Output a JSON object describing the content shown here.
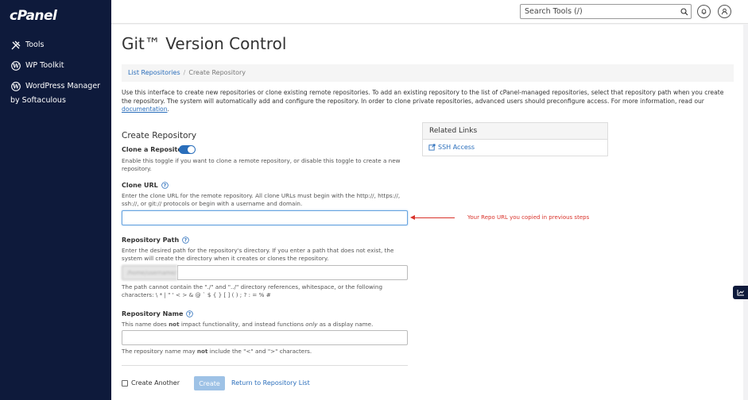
{
  "sidebar": {
    "logo": "cPanel",
    "items": [
      {
        "label": "Tools",
        "icon": "tools-icon"
      },
      {
        "label": "WP Toolkit",
        "icon": "wordpress-icon"
      },
      {
        "label": "WordPress Manager",
        "icon": "wordpress-icon",
        "sublabel": "by Softaculous"
      }
    ]
  },
  "topbar": {
    "search_placeholder": "Search Tools (/)"
  },
  "page": {
    "title": "Git™ Version Control",
    "breadcrumb": {
      "parent": "List Repositories",
      "current": "Create Repository"
    },
    "intro_text": "Use this interface to create new repositories or clone existing remote repositories. To add an existing repository to the list of cPanel-managed repositories, select that repository path when you create the repository. The system will automatically add and configure the repository. In order to clone private repositories, advanced users should preconfigure access. For more information, read our ",
    "intro_link": "documentation",
    "intro_end": ".",
    "section_title": "Create Repository"
  },
  "form": {
    "clone_toggle": {
      "label": "Clone a Repository",
      "description": "Enable this toggle if you want to clone a remote repository, or disable this toggle to create a new repository.",
      "enabled": true
    },
    "clone_url": {
      "label": "Clone URL",
      "description": "Enter the clone URL for the remote repository. All clone URLs must begin with the http://, https://, ssh://, or git:// protocols or begin with a username and domain.",
      "value": ""
    },
    "repo_path": {
      "label": "Repository Path",
      "description": "Enter the desired path for the repository's directory. If you enter a path that does not exist, the system will create the directory when it creates or clones the repository.",
      "prefix": "/home/username/",
      "value": "",
      "note": "The path cannot contain the \"./\" and \"../\" directory references, whitespace, or the following characters: \\ * | \" ' < > & @ ` $ { } [ ] ( ) ; ? : = % #"
    },
    "repo_name": {
      "label": "Repository Name",
      "description_pre": "This name does ",
      "description_not": "not",
      "description_mid": " impact functionality, and instead functions ",
      "description_only": "only",
      "description_post": " as a display name.",
      "value": "",
      "note_pre": "The repository name may ",
      "note_not": "not",
      "note_post": " include the \"<\" and \">\" characters."
    },
    "create_another": {
      "label": "Create Another",
      "checked": false
    },
    "create_button": "Create",
    "return_link": "Return to Repository List"
  },
  "related_links": {
    "title": "Related Links",
    "items": [
      {
        "label": "SSH Access"
      }
    ]
  },
  "annotation": {
    "text": "Your Repo URL you copied in previous steps",
    "color": "#d9332b"
  },
  "colors": {
    "sidebar": "#0e1a3b",
    "accent": "#2a6ebb",
    "button": "#9ec2e6"
  }
}
